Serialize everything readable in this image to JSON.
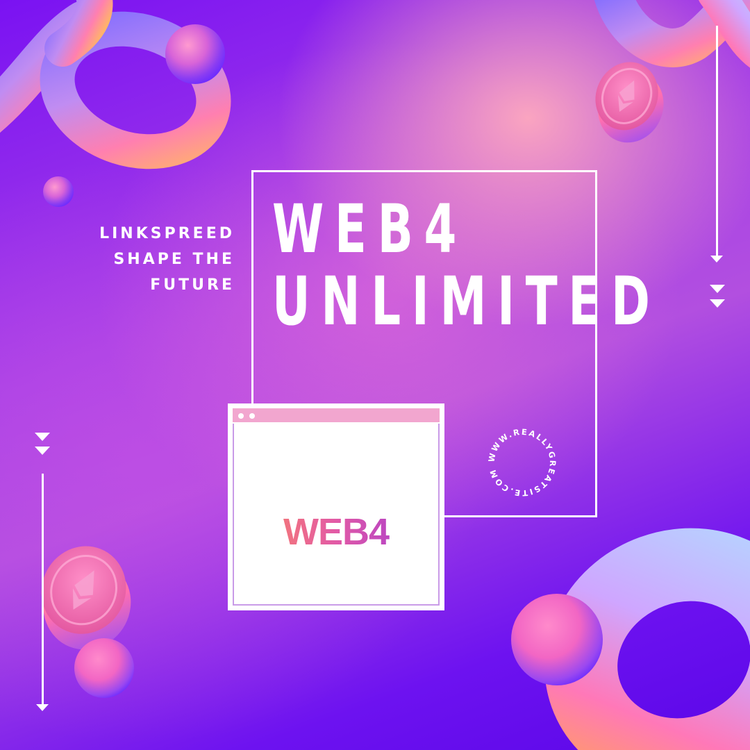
{
  "tagline": {
    "line1": "LINKSPREED",
    "line2": "SHAPE THE",
    "line3": "FUTURE"
  },
  "headline": {
    "line1": "WEB4",
    "line2": "UNLIMITED"
  },
  "browser": {
    "logo_text": "WEB4"
  },
  "badge": {
    "circular_text": "WWW.REALLYGREATSITE.COM"
  },
  "colors": {
    "background_deep": "#6d12f0",
    "background_mid": "#b24fe0",
    "glow_pink": "#ffaabe",
    "browser_bar": "#f2a6cf",
    "logo_gradient_start": "#ff8a5c",
    "logo_gradient_end": "#9b35d8",
    "text": "#ffffff"
  },
  "icons": [
    "down-arrow-icon",
    "double-chevron-down-icon",
    "ethereum-coin-icon"
  ]
}
